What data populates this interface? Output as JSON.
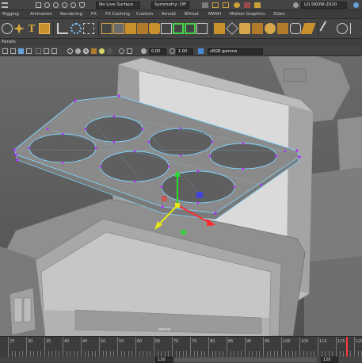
{
  "status_line": {
    "live_surface": "No Live Surface",
    "symmetry": "Symmetry: Off",
    "user_login": "LD.SKOW-2020"
  },
  "shelf_tabs": [
    "Rigging",
    "Animation",
    "Rendering",
    "FX",
    "FX Caching",
    "Custom",
    "Arnold",
    "Bifrost",
    "MASH",
    "Motion Graphics",
    "XGen"
  ],
  "panel_menu": {
    "label": "Panels"
  },
  "panel_toolbar": {
    "exposure_value": "0.00",
    "gamma_value": "1.00",
    "color_space": "sRGB gamma"
  },
  "viewport": {
    "camera_label": "persp"
  },
  "time_slider": {
    "tick_labels": [
      "25",
      "30",
      "35",
      "40",
      "45",
      "50",
      "55",
      "60",
      "65",
      "70",
      "75",
      "80",
      "85",
      "90",
      "95",
      "100",
      "105",
      "110",
      "115",
      "120"
    ],
    "end_frame": "120",
    "range_end": "120"
  },
  "colors": {
    "viewport_bg": "#5c5c5c",
    "selection_cyan": "#7fd7ff",
    "vertex_purple": "#b02cff",
    "move_x": "#ff2a2a",
    "move_y": "#2ddc2d",
    "move_z": "#3a3aff",
    "timeline_marker": "#ff3b3b"
  }
}
